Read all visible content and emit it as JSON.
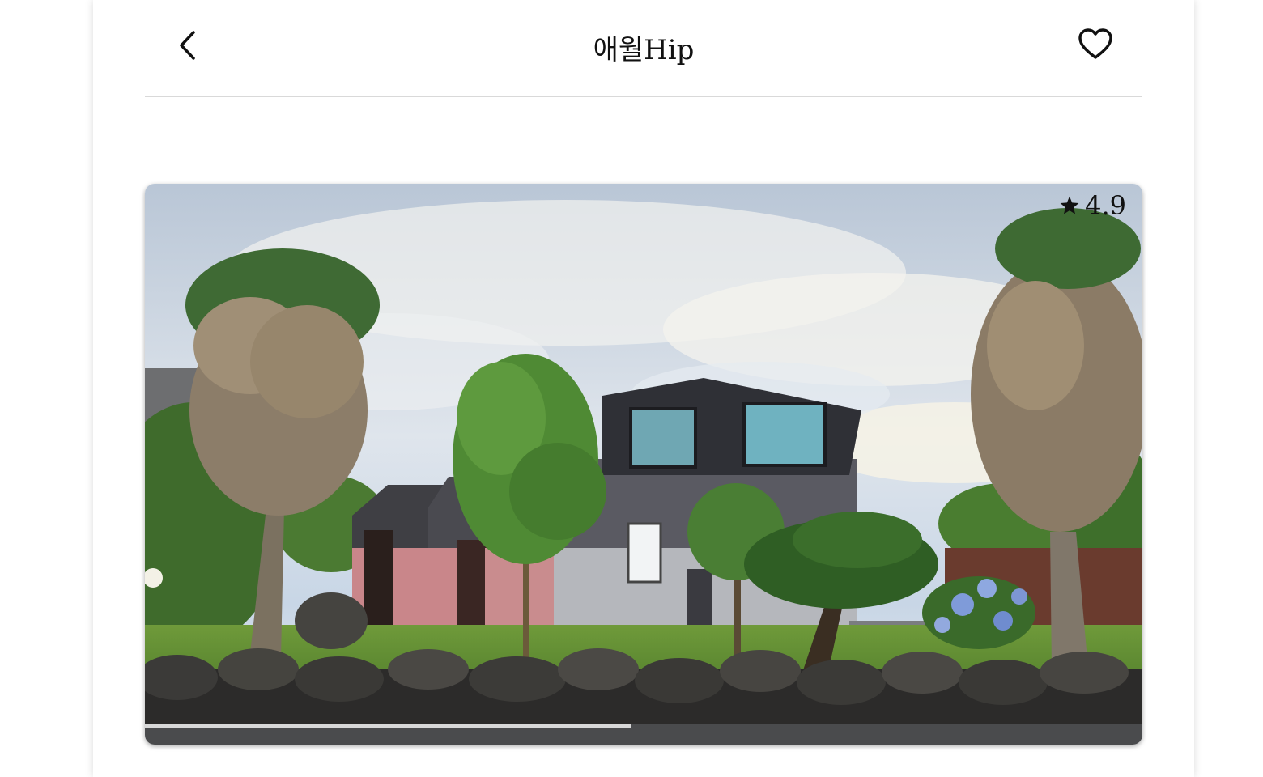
{
  "header": {
    "title": "애월Hip",
    "back_icon": "chevron-left-icon",
    "favorite_icon": "heart-outline-icon"
  },
  "photo": {
    "rating": "4.9",
    "rating_icon": "star-icon"
  },
  "colors": {
    "divider": "#d9d9d9",
    "text": "#111111"
  }
}
